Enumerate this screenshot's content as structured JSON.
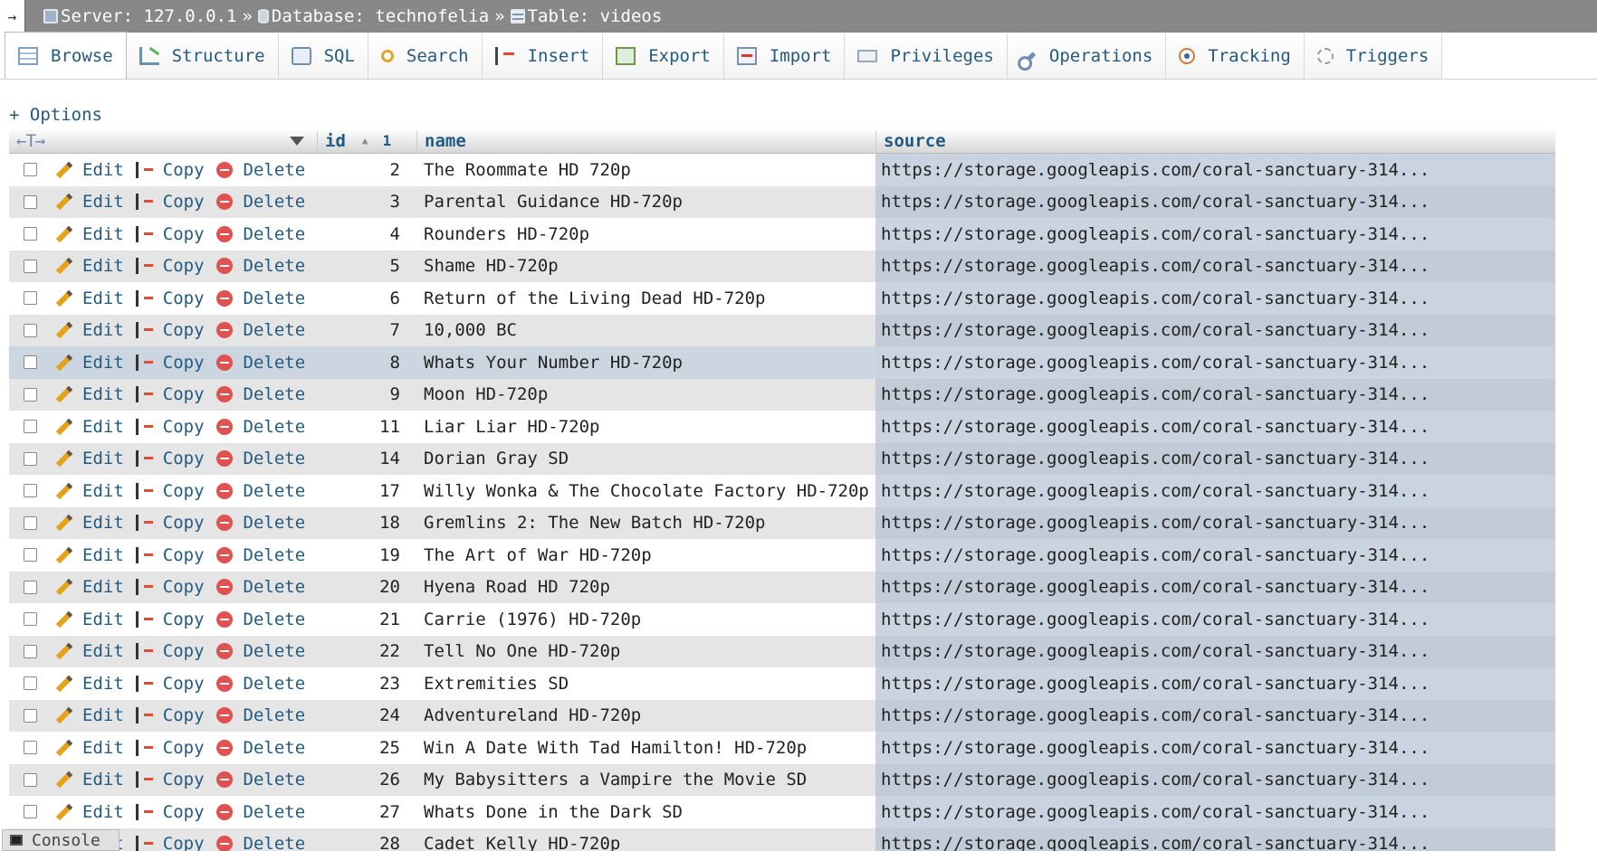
{
  "breadcrumb": {
    "server": "Server: 127.0.0.1",
    "database": "Database: technofelia",
    "table": "Table: videos",
    "separator": "»",
    "toggle": "→"
  },
  "tabs": [
    {
      "label": "Browse",
      "icon": "browse-icon",
      "active": true
    },
    {
      "label": "Structure",
      "icon": "structure-icon"
    },
    {
      "label": "SQL",
      "icon": "sql-icon"
    },
    {
      "label": "Search",
      "icon": "search-icon"
    },
    {
      "label": "Insert",
      "icon": "insert-icon"
    },
    {
      "label": "Export",
      "icon": "export-icon"
    },
    {
      "label": "Import",
      "icon": "import-icon"
    },
    {
      "label": "Privileges",
      "icon": "privileges-icon"
    },
    {
      "label": "Operations",
      "icon": "operations-icon"
    },
    {
      "label": "Tracking",
      "icon": "tracking-icon"
    },
    {
      "label": "Triggers",
      "icon": "triggers-icon"
    }
  ],
  "options_label": "+ Options",
  "table": {
    "header_arrows": "←T→",
    "columns": {
      "id": "id",
      "sort_order": "1",
      "name": "name",
      "source": "source"
    },
    "actions": {
      "edit": "Edit",
      "copy": "Copy",
      "delete": "Delete"
    },
    "rows": [
      {
        "id": "2",
        "name": "The Roommate HD 720p",
        "source": "https://storage.googleapis.com/coral-sanctuary-314..."
      },
      {
        "id": "3",
        "name": "Parental Guidance HD-720p",
        "source": "https://storage.googleapis.com/coral-sanctuary-314..."
      },
      {
        "id": "4",
        "name": "Rounders HD-720p",
        "source": "https://storage.googleapis.com/coral-sanctuary-314..."
      },
      {
        "id": "5",
        "name": "Shame HD-720p",
        "source": "https://storage.googleapis.com/coral-sanctuary-314..."
      },
      {
        "id": "6",
        "name": "Return of the Living Dead HD-720p",
        "source": "https://storage.googleapis.com/coral-sanctuary-314..."
      },
      {
        "id": "7",
        "name": "10,000 BC",
        "source": "https://storage.googleapis.com/coral-sanctuary-314..."
      },
      {
        "id": "8",
        "name": "Whats Your Number HD-720p",
        "source": "https://storage.googleapis.com/coral-sanctuary-314...",
        "highlighted": true
      },
      {
        "id": "9",
        "name": "Moon HD-720p",
        "source": "https://storage.googleapis.com/coral-sanctuary-314..."
      },
      {
        "id": "11",
        "name": "Liar Liar HD-720p",
        "source": "https://storage.googleapis.com/coral-sanctuary-314..."
      },
      {
        "id": "14",
        "name": "Dorian Gray SD",
        "source": "https://storage.googleapis.com/coral-sanctuary-314..."
      },
      {
        "id": "17",
        "name": "Willy Wonka & The Chocolate Factory HD-720p",
        "source": "https://storage.googleapis.com/coral-sanctuary-314..."
      },
      {
        "id": "18",
        "name": "Gremlins 2: The New Batch HD-720p",
        "source": "https://storage.googleapis.com/coral-sanctuary-314..."
      },
      {
        "id": "19",
        "name": "The Art of War HD-720p",
        "source": "https://storage.googleapis.com/coral-sanctuary-314..."
      },
      {
        "id": "20",
        "name": "Hyena Road HD 720p",
        "source": "https://storage.googleapis.com/coral-sanctuary-314..."
      },
      {
        "id": "21",
        "name": "Carrie (1976) HD-720p",
        "source": "https://storage.googleapis.com/coral-sanctuary-314..."
      },
      {
        "id": "22",
        "name": "Tell No One HD-720p",
        "source": "https://storage.googleapis.com/coral-sanctuary-314..."
      },
      {
        "id": "23",
        "name": "Extremities SD",
        "source": "https://storage.googleapis.com/coral-sanctuary-314..."
      },
      {
        "id": "24",
        "name": "Adventureland HD-720p",
        "source": "https://storage.googleapis.com/coral-sanctuary-314..."
      },
      {
        "id": "25",
        "name": "Win A Date With Tad Hamilton! HD-720p",
        "source": "https://storage.googleapis.com/coral-sanctuary-314..."
      },
      {
        "id": "26",
        "name": "My Babysitters a Vampire the Movie SD",
        "source": "https://storage.googleapis.com/coral-sanctuary-314..."
      },
      {
        "id": "27",
        "name": "Whats Done in the Dark SD",
        "source": "https://storage.googleapis.com/coral-sanctuary-314..."
      },
      {
        "id": "28",
        "name": "Cadet Kelly HD-720p",
        "source": "https://storage.googleapis.com/coral-sanctuary-314..."
      }
    ]
  },
  "console_label": "Console"
}
